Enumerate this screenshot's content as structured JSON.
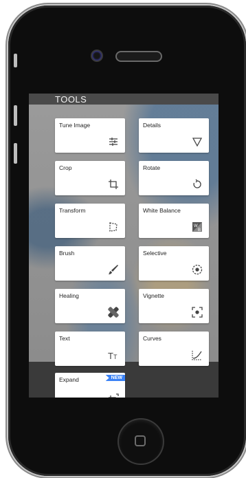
{
  "screen": {
    "title": "TOOLS"
  },
  "tools": [
    {
      "label": "Tune Image",
      "icon": "sliders-icon"
    },
    {
      "label": "Details",
      "icon": "triangle-icon"
    },
    {
      "label": "Crop",
      "icon": "crop-icon"
    },
    {
      "label": "Rotate",
      "icon": "rotate-icon"
    },
    {
      "label": "Transform",
      "icon": "transform-icon"
    },
    {
      "label": "White Balance",
      "icon": "white-balance-icon"
    },
    {
      "label": "Brush",
      "icon": "brush-icon"
    },
    {
      "label": "Selective",
      "icon": "selective-icon"
    },
    {
      "label": "Healing",
      "icon": "bandage-icon"
    },
    {
      "label": "Vignette",
      "icon": "vignette-icon"
    },
    {
      "label": "Text",
      "icon": "text-icon"
    },
    {
      "label": "Curves",
      "icon": "curves-icon"
    },
    {
      "label": "Expand",
      "icon": "expand-icon",
      "badge": "NEW"
    }
  ],
  "colors": {
    "badge": "#3b82f6",
    "card": "#ffffff",
    "icon": "#444444"
  }
}
